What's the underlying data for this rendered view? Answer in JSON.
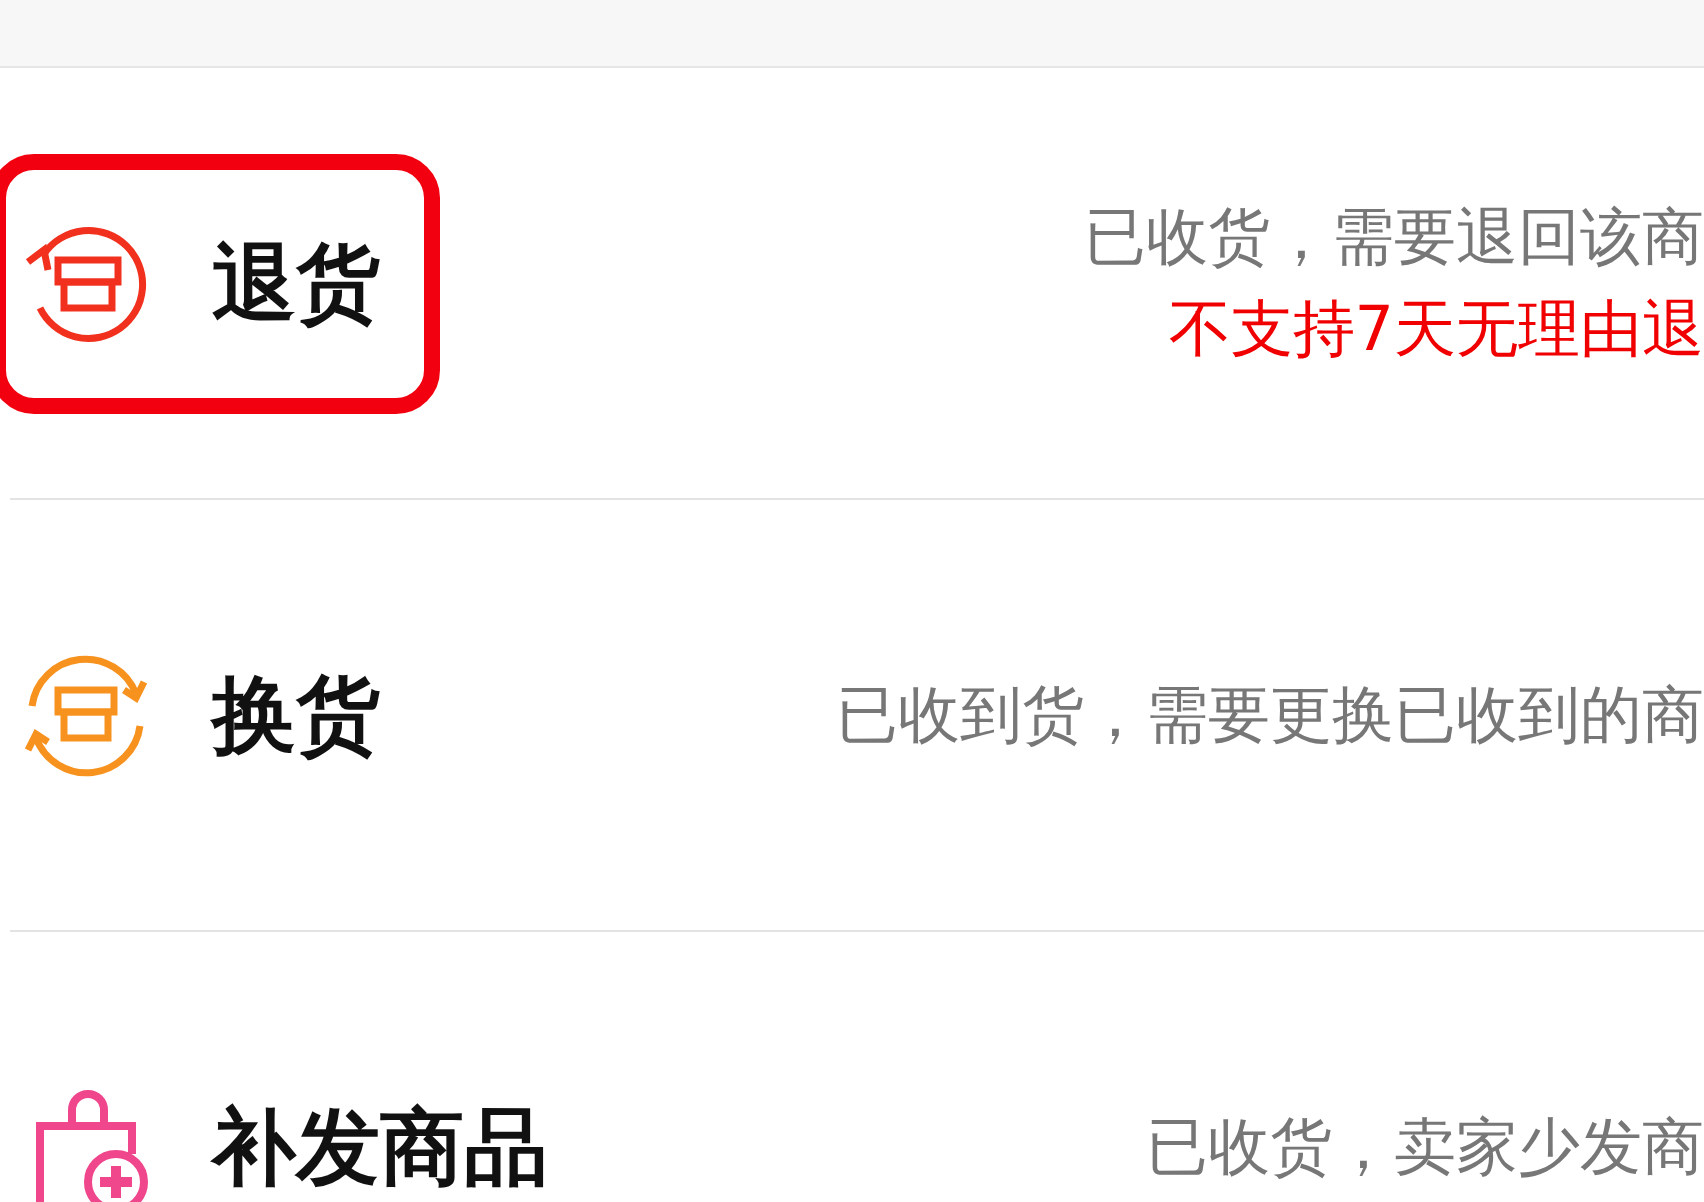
{
  "options": [
    {
      "kind": "return",
      "title": "退货",
      "highlighted": true,
      "description": "已收货，需要退回该商",
      "note": "不支持7天无理由退"
    },
    {
      "kind": "exchange",
      "title": "换货",
      "highlighted": false,
      "description": "已收到货，需要更换已收到的商"
    },
    {
      "kind": "reissue",
      "title": "补发商品",
      "highlighted": false,
      "description": "已收货，卖家少发商"
    }
  ]
}
